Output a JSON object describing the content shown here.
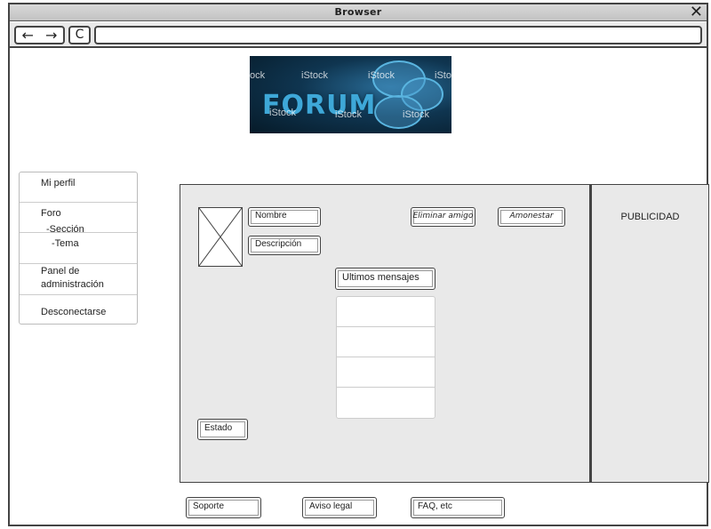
{
  "browser": {
    "title": "Browser",
    "close": "✕",
    "back": "←",
    "forward": "→",
    "reload": "C",
    "url": ""
  },
  "banner": {
    "word": "FORUM",
    "watermarks": [
      "iStock",
      "iStock",
      "iStock",
      "iStock",
      "iStock",
      "iStock",
      "ock"
    ]
  },
  "sidebar": {
    "items": [
      {
        "label": "Mi perfil"
      },
      {
        "label": "Foro",
        "sub": [
          "-Sección",
          "-Tema"
        ]
      },
      {
        "label": "Panel de administración"
      },
      {
        "label": "Desconectarse"
      }
    ]
  },
  "profile": {
    "name_label": "Nombre",
    "description_label": "Descripción",
    "remove_friend_label": "Eliminar amigo",
    "warn_label": "Amonestar",
    "recent_messages_label": "Ultimos mensajes",
    "status_label": "Estado",
    "messages": [
      "",
      "",
      "",
      ""
    ]
  },
  "ad": {
    "label": "PUBLICIDAD"
  },
  "footer": {
    "support_label": "Soporte",
    "legal_label": "Aviso legal",
    "faq_label": "FAQ, etc"
  }
}
